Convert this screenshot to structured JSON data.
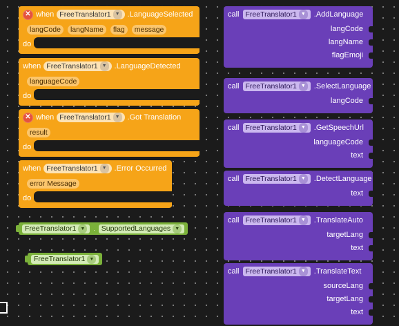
{
  "component": "FreeTranslator1",
  "events": [
    {
      "error_icon": true,
      "keyword": "when",
      "name": ".LanguageSelected",
      "params": [
        "langCode",
        "langName",
        "flag",
        "message"
      ],
      "do_label": "do"
    },
    {
      "error_icon": false,
      "keyword": "when",
      "name": ".LanguageDetected",
      "params": [
        "languageCode"
      ],
      "do_label": "do"
    },
    {
      "error_icon": true,
      "keyword": "when",
      "name": ".Got Translation",
      "params": [
        "result"
      ],
      "do_label": "do"
    },
    {
      "error_icon": false,
      "keyword": "when",
      "name": ".Error Occurred",
      "params": [
        "error Message"
      ],
      "do_label": "do"
    }
  ],
  "getters": {
    "property_getter": {
      "component": "FreeTranslator1",
      "property": "SupportedLanguages"
    },
    "component_getter": {
      "component": "FreeTranslator1"
    }
  },
  "calls": [
    {
      "keyword": "call",
      "method": ".AddLanguage",
      "args": [
        "langCode",
        "langName",
        "flagEmoji"
      ]
    },
    {
      "keyword": "call",
      "method": ".SelectLanguage",
      "args": [
        "langCode"
      ]
    },
    {
      "keyword": "call",
      "method": ".GetSpeechUrl",
      "args": [
        "languageCode",
        "text"
      ]
    },
    {
      "keyword": "call",
      "method": ".DetectLanguage",
      "args": [
        "text"
      ]
    },
    {
      "keyword": "call",
      "method": ".TranslateAuto",
      "args": [
        "targetLang",
        "text"
      ]
    },
    {
      "keyword": "call",
      "method": ".TranslateText",
      "args": [
        "sourceLang",
        "targetLang",
        "text"
      ]
    }
  ],
  "colors": {
    "event": "#f6a418",
    "call": "#6a3fb8",
    "getter": "#7bb13a",
    "workspace": "#1b1b1b"
  },
  "icons": {
    "error": "error-x-icon",
    "dropdown": "dropdown-arrow-icon"
  }
}
